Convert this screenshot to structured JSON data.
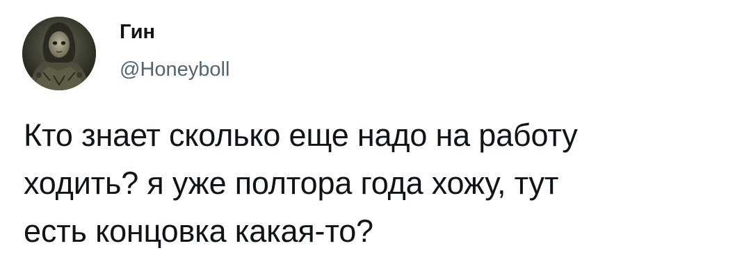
{
  "author": {
    "name": "Гин",
    "handle": "@Honeyboll",
    "avatar_icon": "user-avatar"
  },
  "tweet": {
    "text": "Кто знает сколько еще надо на работу\nходить? я уже полтора года хожу, тут\nесть концовка какая-то?"
  },
  "colors": {
    "text": "#0f1419",
    "secondary_text": "#536471",
    "background": "#ffffff"
  }
}
